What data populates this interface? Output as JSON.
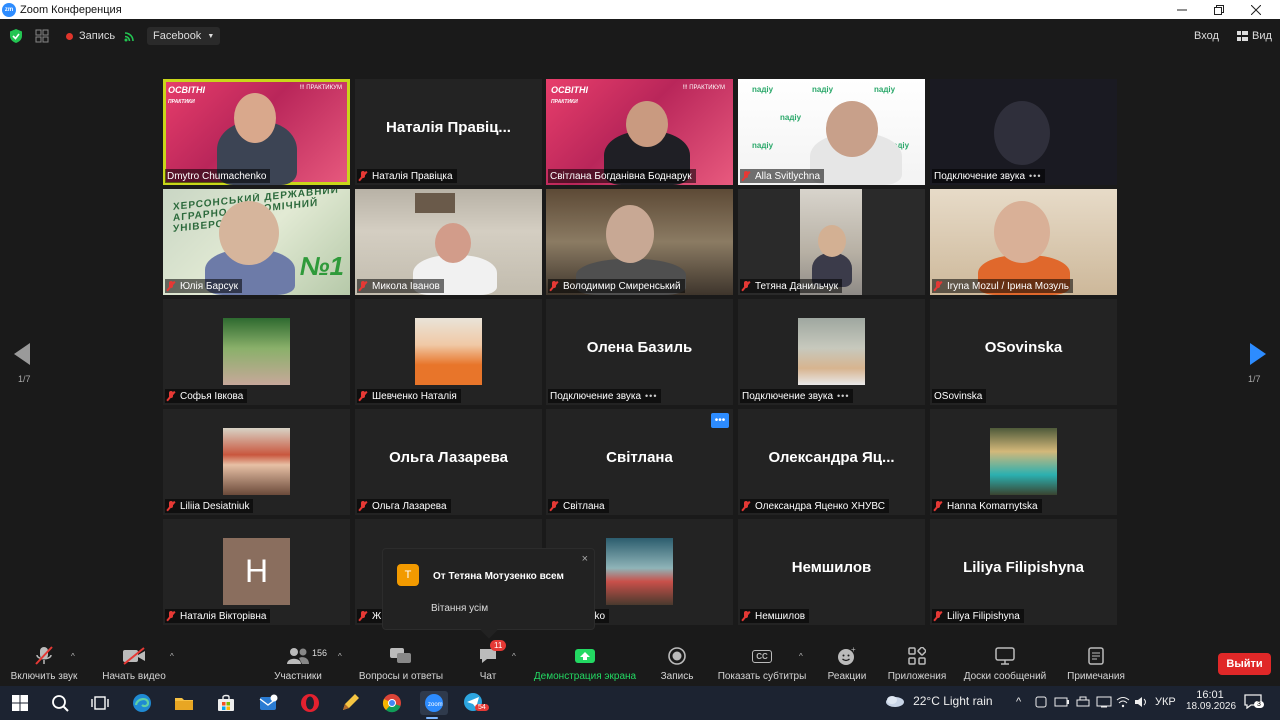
{
  "window": {
    "title": "Zoom Конференция",
    "logo_text": "zm"
  },
  "topbar": {
    "record_label": "Запись",
    "stream_label": "Facebook",
    "signin_label": "Вход",
    "view_label": "Вид"
  },
  "pager": {
    "left": "1/7",
    "right": "1/7"
  },
  "tiles": [
    {
      "name": "Dmytro Chumachenko",
      "big": ""
    },
    {
      "name": "Наталія Правіцка",
      "big": "Наталія Правіц..."
    },
    {
      "name": "Світлана Богданівна Боднарук",
      "big": ""
    },
    {
      "name": "Alla Svitlychna",
      "big": ""
    },
    {
      "name": "Подключение звука",
      "big": ""
    },
    {
      "name": "Юлія Барсук",
      "big": ""
    },
    {
      "name": "Микола Іванов",
      "big": ""
    },
    {
      "name": "Володимир Смиренський",
      "big": ""
    },
    {
      "name": "Тетяна Данильчук",
      "big": ""
    },
    {
      "name": "Iryna Mozul / Ірина Мозуль",
      "big": ""
    },
    {
      "name": "Софья Івкова",
      "big": ""
    },
    {
      "name": "Шевченко Наталія",
      "big": ""
    },
    {
      "name": "Подключение звука",
      "big": "Олена Базиль"
    },
    {
      "name": "Подключение звука",
      "big": ""
    },
    {
      "name": "OSovinska",
      "big": "OSovinska"
    },
    {
      "name": "Liliia Desiatniuk",
      "big": ""
    },
    {
      "name": "Ольга Лазарева",
      "big": "Ольга Лазарева"
    },
    {
      "name": "Світлана",
      "big": "Світлана"
    },
    {
      "name": "Олександра Яценко ХНУВС",
      "big": "Олександра Яц..."
    },
    {
      "name": "Hanna Komarnytska",
      "big": ""
    },
    {
      "name": "Наталія Вікторівна",
      "big": "",
      "initial": "H"
    },
    {
      "name": "Ж",
      "big": ""
    },
    {
      "name": "a Shkolenko",
      "big": ""
    },
    {
      "name": "Немшилов",
      "big": "Немшилов"
    },
    {
      "name": "Liliya Filipishyna",
      "big": "Liliya Filipishyna"
    }
  ],
  "video_text": {
    "osvitni": "ОСВІТНІ",
    "praktyky": "ПРАКТИКИ",
    "org": "!!! ПРАКТИКУМ",
    "nadiy": "naдiy",
    "university": "ХЕРСОНСЬКИЙ ДЕРЖАВНИЙ АГРАРНО-ЕКОНОМІЧНИЙ УНІВЕРСИТЕТ",
    "no1": "№1"
  },
  "chat_popup": {
    "avatar": "Т",
    "from": "От Тетяна  Мотузенко всем",
    "message": "Вітання усім",
    "close": "×"
  },
  "toolbar": {
    "mute": "Включить звук",
    "video": "Начать видео",
    "participants": "Участники",
    "participants_count": "156",
    "qa": "Вопросы и ответы",
    "chat": "Чат",
    "chat_badge": "11",
    "share": "Демонстрация экрана",
    "record": "Запись",
    "subtitles": "Показать субтитры",
    "subtitles_icon": "CC",
    "reactions": "Реакции",
    "apps": "Приложения",
    "whiteboards": "Доски сообщений",
    "notes": "Примечания",
    "leave": "Выйти"
  },
  "taskbar": {
    "weather": "22°C  Light rain",
    "lang": "УКР",
    "time": "16:01",
    "date": "18.09.2026",
    "notif": "3",
    "telegram_badge": "54"
  },
  "colors": {
    "accent": "#2d8cff",
    "active_speaker": "#c9d61a",
    "leave": "#e02828",
    "share": "#23d963"
  }
}
